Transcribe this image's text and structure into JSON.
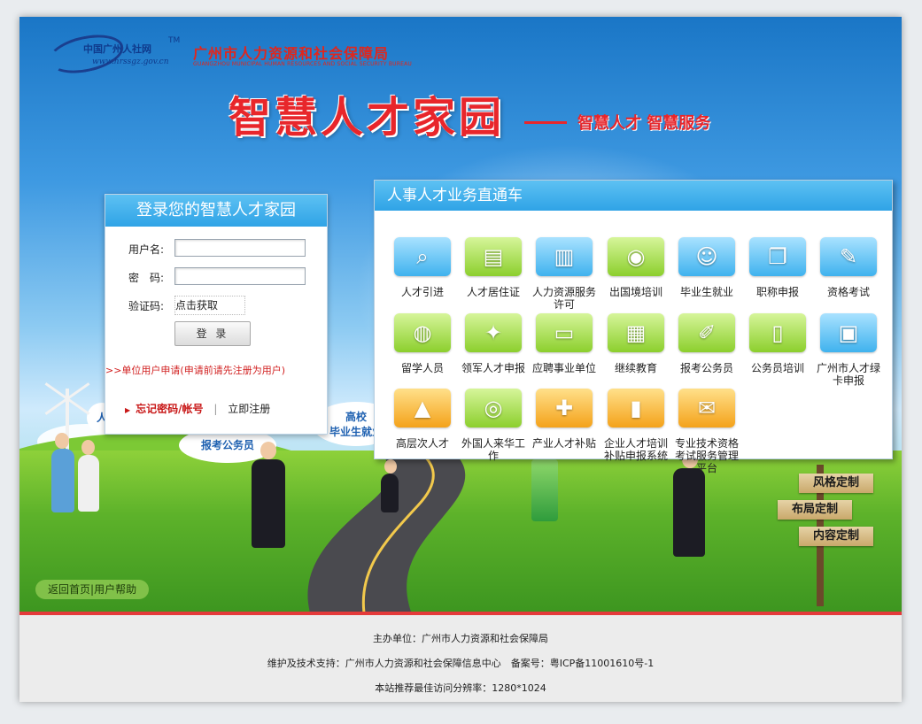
{
  "header": {
    "logo_text": "中国广州人社网",
    "logo_tm": "TM",
    "logo_url": "www.hrssgz.gov.cn",
    "bureau_cn": "广州市人力资源和社会保障局",
    "bureau_en": "GUANGZHOU MUNICIPAL HUMAN RESOURCES AND SOCIAL SECURITY BUREAU",
    "slogan_big": "智慧人才家园",
    "slogan_small": "智慧人才 智慧服务"
  },
  "login": {
    "title": "登录您的智慧人才家园",
    "username_label": "用户名:",
    "password_label": "密　码:",
    "captcha_label": "验证码:",
    "captcha_text": "点击获取",
    "login_button": "登 录",
    "apply_link": ">>单位用户申请(申请前请先注册为用户)",
    "forgot_link": "忘记密码/帐号",
    "separator": "|",
    "register_link": "立即注册"
  },
  "services": {
    "title": "人事人才业务直通车",
    "items": [
      {
        "label": "人才引进",
        "icon": "magnifier-icon",
        "color": "#3fb2ee"
      },
      {
        "label": "人才居住证",
        "icon": "id-card-icon",
        "color": "#8ccf2d"
      },
      {
        "label": "人力资源服务许可",
        "icon": "building-icon",
        "color": "#3fb2ee"
      },
      {
        "label": "出国境培训",
        "icon": "globe-worker-icon",
        "color": "#8ccf2d"
      },
      {
        "label": "毕业生就业",
        "icon": "worker-icon",
        "color": "#3fb2ee"
      },
      {
        "label": "职称申报",
        "icon": "book-icon",
        "color": "#3fb2ee"
      },
      {
        "label": "资格考试",
        "icon": "exam-icon",
        "color": "#3fb2ee"
      },
      {
        "label": "留学人员",
        "icon": "globe-icon",
        "color": "#8ccf2d"
      },
      {
        "label": "领军人才申报",
        "icon": "graduate-icon",
        "color": "#8ccf2d"
      },
      {
        "label": "应聘事业单位",
        "icon": "folder-icon",
        "color": "#8ccf2d"
      },
      {
        "label": "继续教育",
        "icon": "blocks-icon",
        "color": "#8ccf2d"
      },
      {
        "label": "报考公务员",
        "icon": "pen-icon",
        "color": "#8ccf2d"
      },
      {
        "label": "公务员培训",
        "icon": "books-icon",
        "color": "#8ccf2d"
      },
      {
        "label": "广州市人才绿卡申报",
        "icon": "green-card-icon",
        "color": "#3fb2ee"
      },
      {
        "label": "高层次人才",
        "icon": "climber-icon",
        "color": "#f4a21a"
      },
      {
        "label": "外国人来华工作",
        "icon": "world-search-icon",
        "color": "#8ccf2d"
      },
      {
        "label": "产业人才补贴",
        "icon": "engineer-icon",
        "color": "#f4a21a"
      },
      {
        "label": "企业人才培训补贴申报系统",
        "icon": "office-tower-icon",
        "color": "#f4a21a"
      },
      {
        "label": "专业技术资格考试服务管理平台",
        "icon": "certificate-icon",
        "color": "#f4a21a"
      }
    ]
  },
  "scene": {
    "bubble_gaoxiao": "高校",
    "bubble_biye": "毕业生就业",
    "bubble_gwy": "报考公务员",
    "bubble_ren": "人"
  },
  "signs": [
    "风格定制",
    "布局定制",
    "内容定制"
  ],
  "bottom_links": {
    "home": "返回首页",
    "separator": "|",
    "help": "用户帮助"
  },
  "footer": {
    "sponsor": "主办单位：广州市人力资源和社会保障局",
    "support": "维护及技术支持：广州市人力资源和社会保障信息中心　备案号：粤ICP备11001610号-1",
    "resolution": "本站推荐最佳访问分辨率：1280*1024"
  }
}
